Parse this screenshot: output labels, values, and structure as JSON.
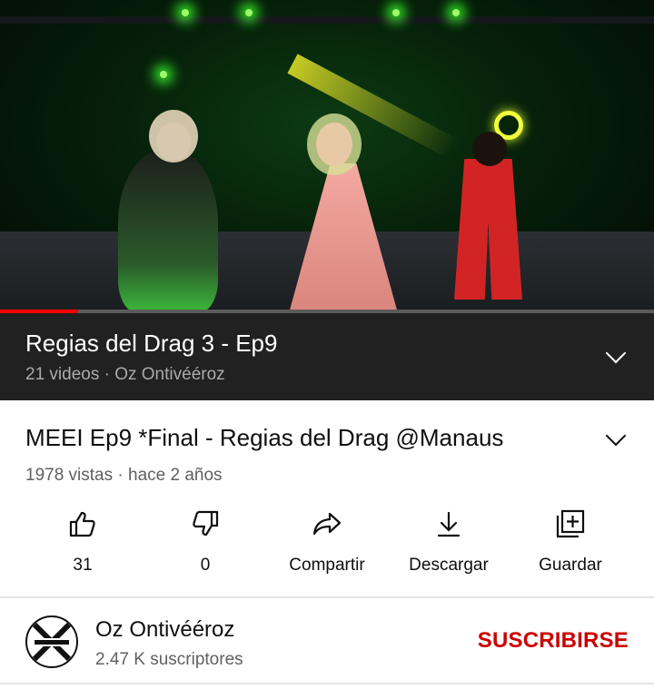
{
  "player": {
    "progress_fraction": 0.12,
    "accent_color": "#ff0000"
  },
  "playlist": {
    "title": "Regias del Drag 3 - Ep9",
    "subtitle": "21 videos · Oz Ontivééroz",
    "expand_icon": "chevron-down-icon"
  },
  "video": {
    "title": "MEEI Ep9 *Final - Regias del Drag @Manaus",
    "meta": "1978 vistas · hace 2 años",
    "expand_icon": "chevron-down-icon"
  },
  "actions": [
    {
      "label": "31",
      "icon": "thumbs-up-icon"
    },
    {
      "label": "0",
      "icon": "thumbs-down-icon"
    },
    {
      "label": "Compartir",
      "icon": "share-icon"
    },
    {
      "label": "Descargar",
      "icon": "download-icon"
    },
    {
      "label": "Guardar",
      "icon": "add-to-playlist-icon"
    }
  ],
  "channel": {
    "name": "Oz Ontivééroz",
    "subscribers": "2.47 K suscriptores",
    "subscribe_label": "SUSCRIBIRSE",
    "subscribe_color": "#cc0000"
  }
}
